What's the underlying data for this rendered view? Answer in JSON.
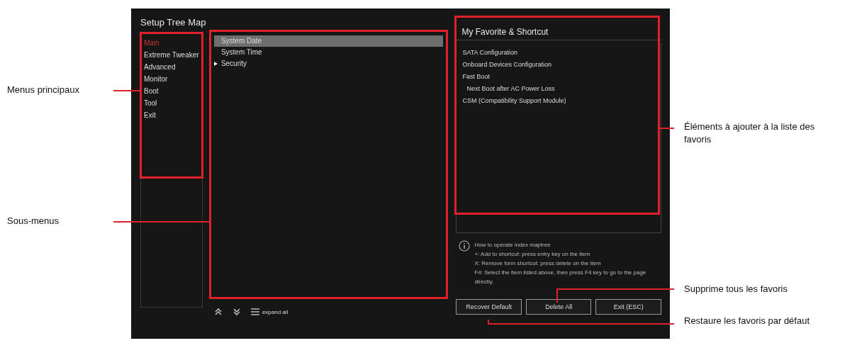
{
  "screen": {
    "title": "Setup Tree Map",
    "main_menus": [
      {
        "label": "Main",
        "selected": true
      },
      {
        "label": "Extreme Tweaker",
        "selected": false
      },
      {
        "label": "Advanced",
        "selected": false
      },
      {
        "label": "Monitor",
        "selected": false
      },
      {
        "label": "Boot",
        "selected": false
      },
      {
        "label": "Tool",
        "selected": false
      },
      {
        "label": "Exit",
        "selected": false
      }
    ],
    "submenus": [
      {
        "label": "System Date",
        "selected": true,
        "kind": "item"
      },
      {
        "label": "System Time",
        "selected": false,
        "kind": "item"
      },
      {
        "label": "Security",
        "selected": false,
        "kind": "folder"
      }
    ],
    "toolbar": {
      "expand_label": "expand all"
    },
    "favorites": {
      "title": "My Favorite & Shortcut",
      "items": [
        {
          "label": "SATA Configuration"
        },
        {
          "label": "Onboard Devices Configuration"
        },
        {
          "label": "Fast Boot",
          "children": [
            {
              "label": "Next Boot after AC Power Loss"
            }
          ]
        },
        {
          "label": "CSM (Compatibility Support Module)"
        }
      ]
    },
    "help": [
      "How to operate index maptree",
      "+: Add to shortcut: press entry key on the item",
      "X: Remove form shortcut: press delete on the item",
      "F4: Select the item listed above, then press F4 key to go to the page directly."
    ],
    "buttons": [
      "Recover Default",
      "Delete All",
      "Exit (ESC)"
    ]
  },
  "callouts": [
    "Menus principaux",
    "Sous-menus",
    "Éléments à ajouter à la liste des favoris",
    "Supprime tous les favoris",
    "Restaure les favoris par défaut"
  ]
}
